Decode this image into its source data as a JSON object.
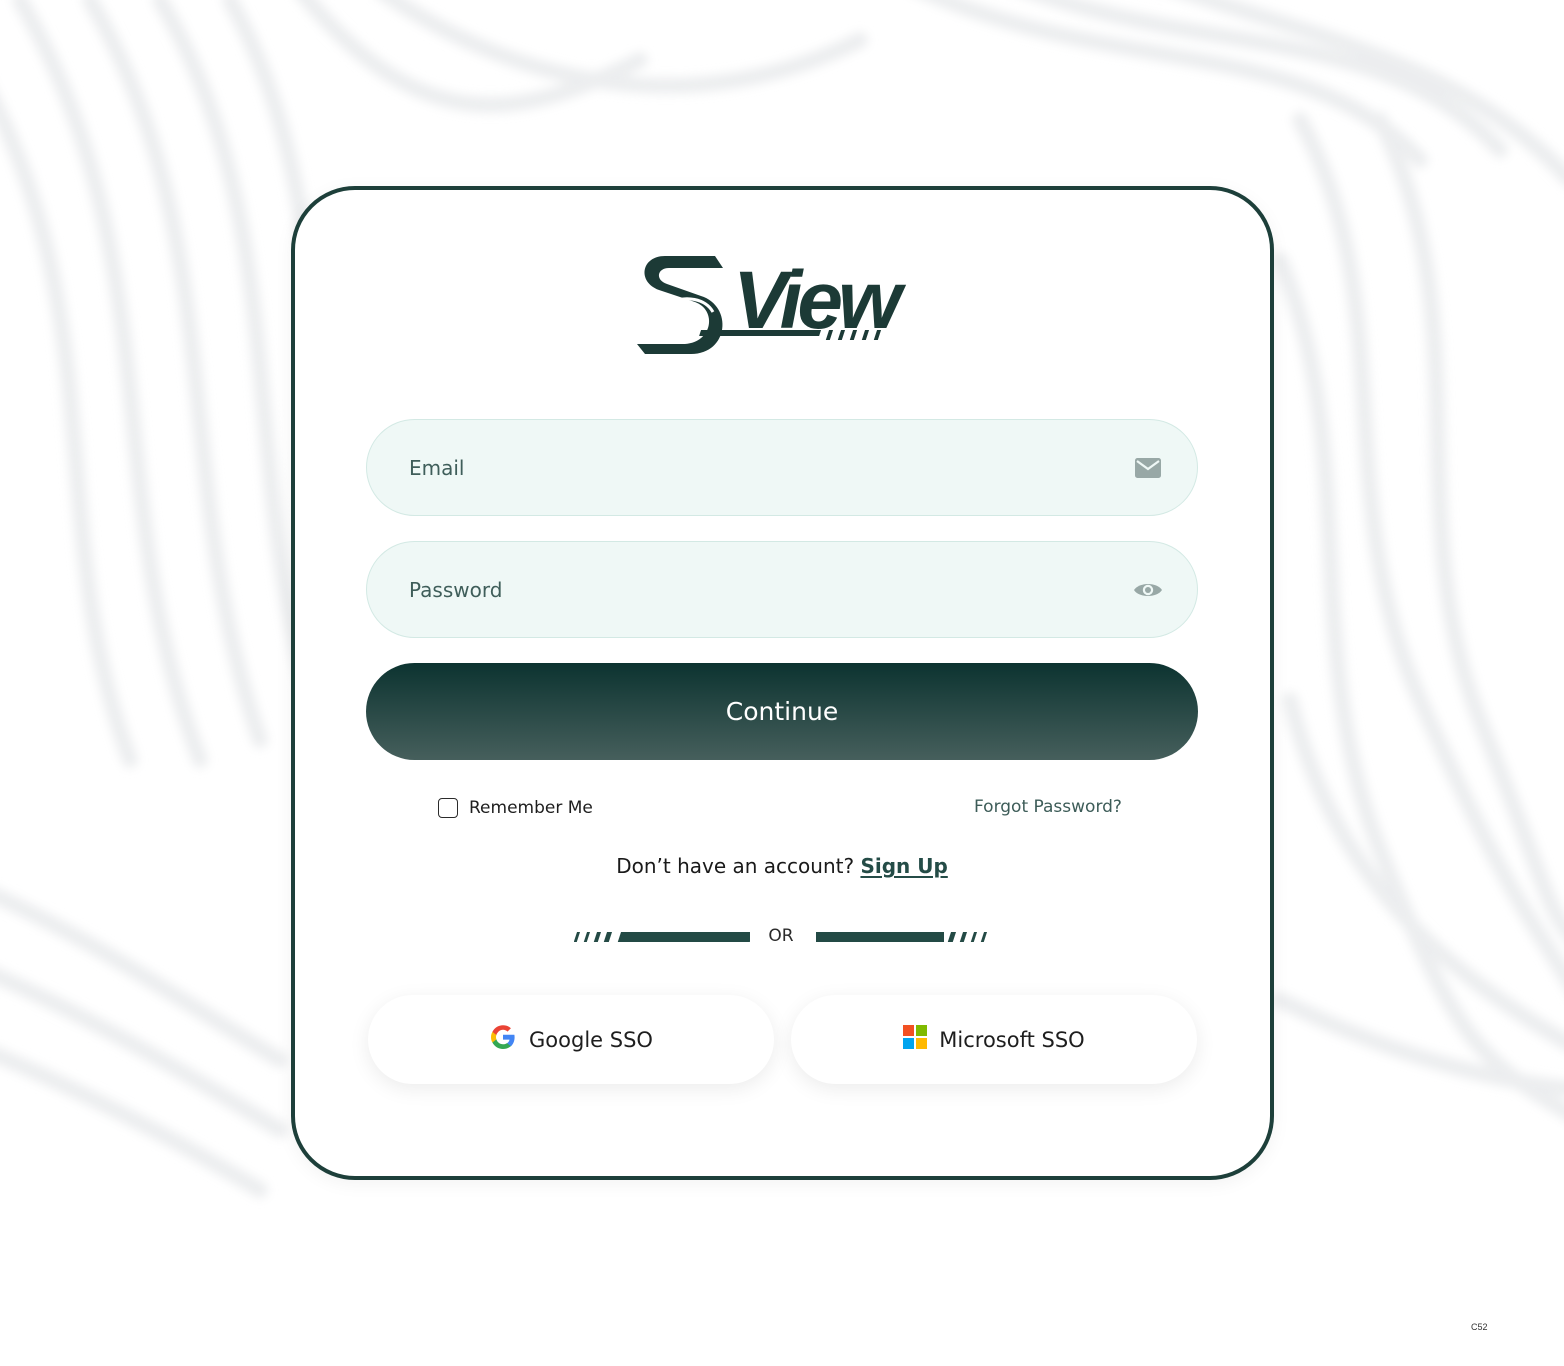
{
  "brand": {
    "logo_text": "SView"
  },
  "form": {
    "email_placeholder": "Email",
    "password_placeholder": "Password",
    "continue_label": "Continue",
    "remember_label": "Remember Me",
    "forgot_label": "Forgot Password?",
    "signup_prompt": "Don’t have an account?",
    "signup_link": "Sign Up",
    "divider_label": "OR"
  },
  "sso": {
    "google_label": "Google SSO",
    "microsoft_label": "Microsoft SSO"
  },
  "icons": {
    "email": "envelope-icon",
    "password": "eye-icon",
    "google": "google-logo-icon",
    "microsoft": "microsoft-logo-icon"
  },
  "colors": {
    "accent_dark": "#0c3330",
    "accent": "#244c47",
    "field_bg": "#eff8f6",
    "card_border": "#1d3f3a"
  },
  "footer": {
    "corner_label": "C52"
  }
}
